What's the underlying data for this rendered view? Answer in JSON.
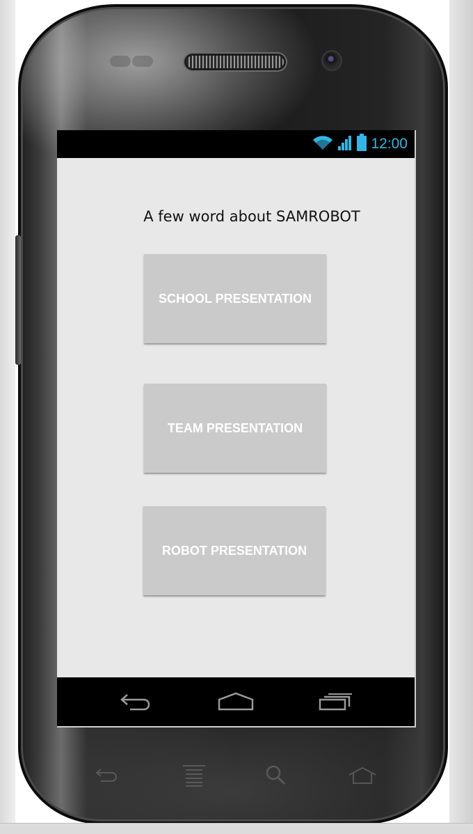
{
  "status_bar": {
    "time": "12:00",
    "icons": [
      "wifi-icon",
      "signal-icon",
      "battery-icon"
    ],
    "accent_color": "#33b5e5"
  },
  "app": {
    "title": "A few word about SAMROBOT",
    "buttons": {
      "school": "SCHOOL PRESENTATION",
      "team": "TEAM PRESENTATION",
      "robot": "ROBOT PRESENTATION"
    },
    "background_color": "#e8e8e8",
    "button_color": "#cacaca"
  },
  "nav_bar": {
    "icons": [
      "back-icon",
      "home-icon",
      "recent-apps-icon"
    ]
  },
  "hardware_keys": {
    "icons": [
      "hw-back-icon",
      "hw-menu-icon",
      "hw-search-icon",
      "hw-home-icon"
    ]
  }
}
